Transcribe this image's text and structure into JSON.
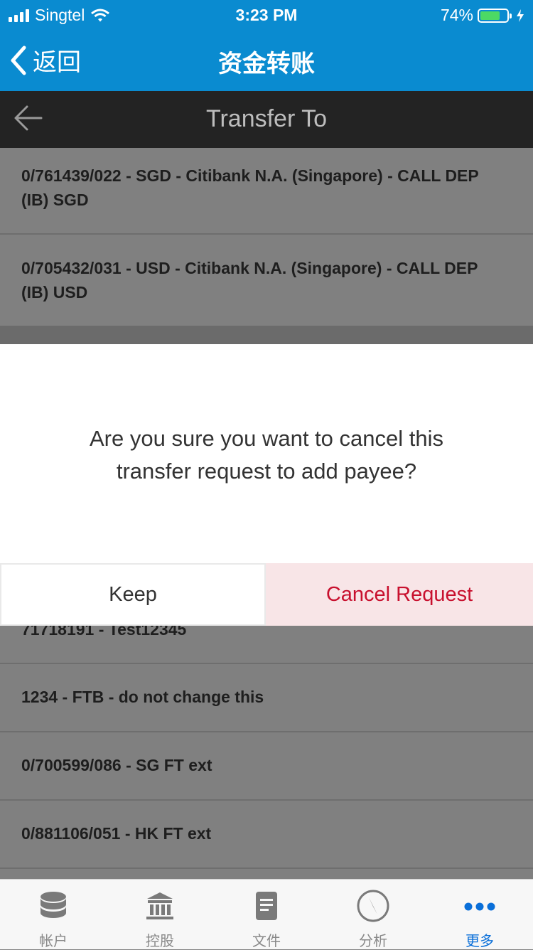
{
  "status": {
    "carrier": "Singtel",
    "time": "3:23 PM",
    "battery": "74%",
    "battery_level": 0.74
  },
  "nav": {
    "back_label": "返回",
    "title": "资金转账"
  },
  "subheader": {
    "title": "Transfer To"
  },
  "accounts": [
    {
      "line1": "0/761439/022 - SGD - Citibank N.A. (Singapore) - CALL DEP",
      "line2": "(IB) SGD"
    },
    {
      "line1": "0/705432/031 - USD - Citibank N.A. (Singapore) - CALL DEP",
      "line2": "(IB) USD"
    },
    {
      "line1": "71718191 - Test12345",
      "line2": ""
    },
    {
      "line1": "1234 - FTB - do not change this",
      "line2": ""
    },
    {
      "line1": "0/700599/086 - SG FT ext",
      "line2": ""
    },
    {
      "line1": "0/881106/051 - HK FT ext",
      "line2": ""
    }
  ],
  "dialog": {
    "message_line1": "Are you sure you want to cancel this",
    "message_line2": "transfer request to add payee?",
    "keep_label": "Keep",
    "cancel_label": "Cancel Request"
  },
  "tabs": [
    {
      "label": "帐户",
      "icon": "database-icon"
    },
    {
      "label": "控股",
      "icon": "bank-icon"
    },
    {
      "label": "文件",
      "icon": "document-icon"
    },
    {
      "label": "分析",
      "icon": "compass-icon"
    },
    {
      "label": "更多",
      "icon": "more-dots-icon",
      "active": true
    }
  ],
  "colors": {
    "brand": "#0a8bd0",
    "cancel_red": "#c8102e",
    "active_tab": "#0a6fd9"
  }
}
